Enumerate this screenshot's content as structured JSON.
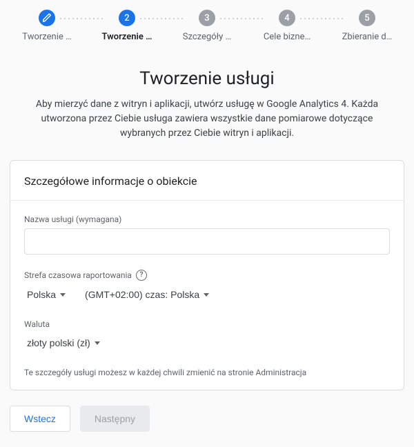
{
  "stepper": {
    "steps": [
      {
        "label": "Tworzenie …",
        "state": "done"
      },
      {
        "label": "Tworzenie …",
        "state": "active"
      },
      {
        "label": "Szczegóły …",
        "state": "pending"
      },
      {
        "label": "Cele bizne…",
        "state": "pending"
      },
      {
        "label": "Zbieranie d…",
        "state": "pending"
      }
    ]
  },
  "page": {
    "title": "Tworzenie usługi",
    "subtitle": "Aby mierzyć dane z witryn i aplikacji, utwórz usługę w Google Analytics 4. Każda utworzona przez Ciebie usługa zawiera wszystkie dane pomiarowe dotyczące wybranych przez Ciebie witryn i aplikacji."
  },
  "card": {
    "header": "Szczegółowe informacje o obiekcie",
    "name_field": {
      "label": "Nazwa usługi (wymagana)",
      "value": ""
    },
    "timezone_field": {
      "label": "Strefa czasowa raportowania",
      "country": "Polska",
      "tz": "(GMT+02:00) czas: Polska"
    },
    "currency_field": {
      "label": "Waluta",
      "value": "złoty polski (zł)"
    },
    "note": "Te szczegóły usługi możesz w każdej chwili zmienić na stronie Administracja"
  },
  "footer": {
    "back": "Wstecz",
    "next": "Następny"
  }
}
